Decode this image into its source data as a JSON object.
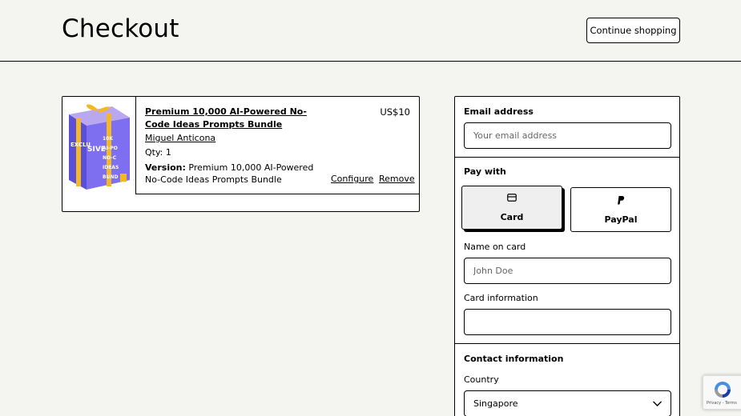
{
  "header": {
    "title": "Checkout",
    "continue_label": "Continue shopping"
  },
  "cart": {
    "item": {
      "title": "Premium 10,000 AI-Powered No-Code Ideas Prompts Bundle",
      "author": "Miguel Anticona",
      "qty_label": "Qty:",
      "qty_value": "1",
      "version_label": "Version:",
      "version_value": "Premium 10,000 AI-Powered No-Code Ideas Prompts Bundle",
      "price": "US$10",
      "configure_label": "Configure",
      "remove_label": "Remove",
      "thumbnail_lines": [
        "EXCLU",
        "SIVE",
        "10K",
        "AI-PO",
        "NO-C",
        "IDEAS",
        "BUND"
      ]
    }
  },
  "form": {
    "email_label": "Email address",
    "email_placeholder": "Your email address",
    "pay_with_label": "Pay with",
    "pay_options": {
      "card": "Card",
      "paypal": "PayPal"
    },
    "name_label": "Name on card",
    "name_placeholder": "John Doe",
    "card_info_label": "Card information",
    "contact_label": "Contact information",
    "country_label": "Country",
    "country_value": "Singapore"
  },
  "recaptcha": {
    "links": "Privacy - Terms"
  }
}
